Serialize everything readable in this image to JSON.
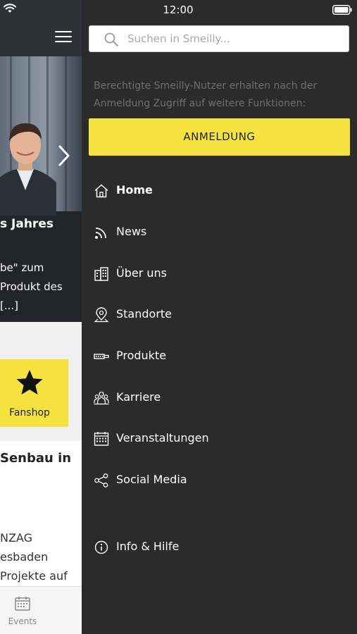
{
  "status_bar": {
    "time": "12:00"
  },
  "background_app": {
    "hero_title": "s Jahres",
    "hero_text_lines": [
      "be\" zum",
      "Produkt des",
      "[...]"
    ],
    "fanshop_label": "Fanshop",
    "article_title": "Senbau in",
    "article_text_lines": [
      "NZAG",
      "esbaden",
      "Projekte auf"
    ],
    "tab_events_label": "Events"
  },
  "drawer": {
    "search": {
      "placeholder": "Suchen in Smeilly..."
    },
    "login_hint": "Berechtigte Smeilly-Nutzer erhalten nach der Anmeldung Zugriff auf weitere Funktionen:",
    "login_button": "ANMELDUNG",
    "nav_items": [
      {
        "label": "Home",
        "icon": "home-icon",
        "active": true
      },
      {
        "label": "News",
        "icon": "rss-icon",
        "active": false
      },
      {
        "label": "Über uns",
        "icon": "building-icon",
        "active": false
      },
      {
        "label": "Standorte",
        "icon": "map-pin-icon",
        "active": false
      },
      {
        "label": "Produkte",
        "icon": "product-icon",
        "active": false
      },
      {
        "label": "Karriere",
        "icon": "people-icon",
        "active": false
      },
      {
        "label": "Veranstaltungen",
        "icon": "calendar-icon",
        "active": false
      },
      {
        "label": "Social Media",
        "icon": "share-icon",
        "active": false
      },
      {
        "label": "Info & Hilfe",
        "icon": "info-icon",
        "active": false
      }
    ]
  },
  "colors": {
    "drawer_bg": "#2b2b2b",
    "accent_yellow": "#f7e33f",
    "top_bar": "#2e3238"
  }
}
